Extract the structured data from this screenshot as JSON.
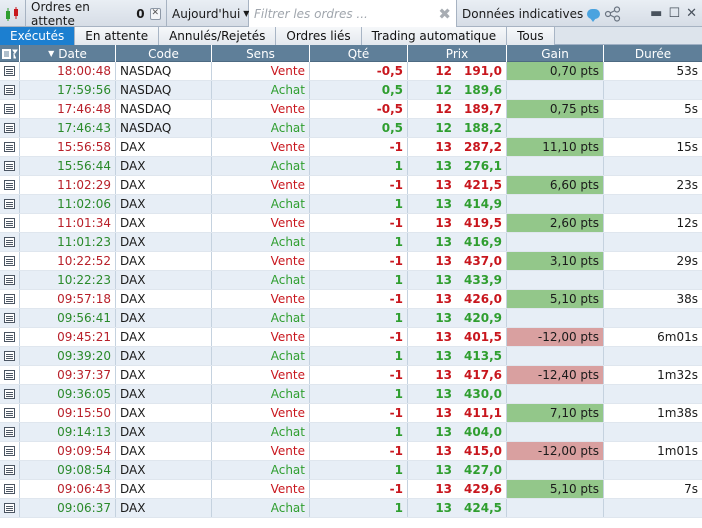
{
  "toolbar": {
    "title": "Ordres en attente",
    "pending_count": "0",
    "date_filter": "Aujourd'hui",
    "filter_placeholder": "Filtrer les ordres ...",
    "data_label": "Données indicatives"
  },
  "tabs": [
    {
      "label": "Exécutés",
      "active": true
    },
    {
      "label": "En attente",
      "active": false
    },
    {
      "label": "Annulés/Rejetés",
      "active": false
    },
    {
      "label": "Ordres liés",
      "active": false
    },
    {
      "label": "Trading automatique",
      "active": false
    },
    {
      "label": "Tous",
      "active": false
    }
  ],
  "columns": {
    "date": "Date",
    "code": "Code",
    "sens": "Sens",
    "qte": "Qté",
    "prix": "Prix",
    "gain": "Gain",
    "duree": "Durée"
  },
  "colors": {
    "sell": "#c8161d",
    "buy": "#2f9e2f",
    "gain_positive": "#93c78a",
    "gain_negative": "#d9a0a0",
    "active_tab": "#1c7fd0",
    "header": "#5f7f99"
  },
  "rows": [
    {
      "date": "18:00:48",
      "code": "NASDAQ",
      "sens": "Vente",
      "qte": "-0,5",
      "prix_big": "12",
      "prix_small": "191,0",
      "gain": "0,70 pts",
      "duree": "53s"
    },
    {
      "date": "17:59:56",
      "code": "NASDAQ",
      "sens": "Achat",
      "qte": "0,5",
      "prix_big": "12",
      "prix_small": "189,6",
      "gain": "",
      "duree": ""
    },
    {
      "date": "17:46:48",
      "code": "NASDAQ",
      "sens": "Vente",
      "qte": "-0,5",
      "prix_big": "12",
      "prix_small": "189,7",
      "gain": "0,75 pts",
      "duree": "5s"
    },
    {
      "date": "17:46:43",
      "code": "NASDAQ",
      "sens": "Achat",
      "qte": "0,5",
      "prix_big": "12",
      "prix_small": "188,2",
      "gain": "",
      "duree": ""
    },
    {
      "date": "15:56:58",
      "code": "DAX",
      "sens": "Vente",
      "qte": "-1",
      "prix_big": "13",
      "prix_small": "287,2",
      "gain": "11,10 pts",
      "duree": "15s"
    },
    {
      "date": "15:56:44",
      "code": "DAX",
      "sens": "Achat",
      "qte": "1",
      "prix_big": "13",
      "prix_small": "276,1",
      "gain": "",
      "duree": ""
    },
    {
      "date": "11:02:29",
      "code": "DAX",
      "sens": "Vente",
      "qte": "-1",
      "prix_big": "13",
      "prix_small": "421,5",
      "gain": "6,60 pts",
      "duree": "23s"
    },
    {
      "date": "11:02:06",
      "code": "DAX",
      "sens": "Achat",
      "qte": "1",
      "prix_big": "13",
      "prix_small": "414,9",
      "gain": "",
      "duree": ""
    },
    {
      "date": "11:01:34",
      "code": "DAX",
      "sens": "Vente",
      "qte": "-1",
      "prix_big": "13",
      "prix_small": "419,5",
      "gain": "2,60 pts",
      "duree": "12s"
    },
    {
      "date": "11:01:23",
      "code": "DAX",
      "sens": "Achat",
      "qte": "1",
      "prix_big": "13",
      "prix_small": "416,9",
      "gain": "",
      "duree": ""
    },
    {
      "date": "10:22:52",
      "code": "DAX",
      "sens": "Vente",
      "qte": "-1",
      "prix_big": "13",
      "prix_small": "437,0",
      "gain": "3,10 pts",
      "duree": "29s"
    },
    {
      "date": "10:22:23",
      "code": "DAX",
      "sens": "Achat",
      "qte": "1",
      "prix_big": "13",
      "prix_small": "433,9",
      "gain": "",
      "duree": ""
    },
    {
      "date": "09:57:18",
      "code": "DAX",
      "sens": "Vente",
      "qte": "-1",
      "prix_big": "13",
      "prix_small": "426,0",
      "gain": "5,10 pts",
      "duree": "38s"
    },
    {
      "date": "09:56:41",
      "code": "DAX",
      "sens": "Achat",
      "qte": "1",
      "prix_big": "13",
      "prix_small": "420,9",
      "gain": "",
      "duree": ""
    },
    {
      "date": "09:45:21",
      "code": "DAX",
      "sens": "Vente",
      "qte": "-1",
      "prix_big": "13",
      "prix_small": "401,5",
      "gain": "-12,00 pts",
      "duree": "6m01s"
    },
    {
      "date": "09:39:20",
      "code": "DAX",
      "sens": "Achat",
      "qte": "1",
      "prix_big": "13",
      "prix_small": "413,5",
      "gain": "",
      "duree": ""
    },
    {
      "date": "09:37:37",
      "code": "DAX",
      "sens": "Vente",
      "qte": "-1",
      "prix_big": "13",
      "prix_small": "417,6",
      "gain": "-12,40 pts",
      "duree": "1m32s"
    },
    {
      "date": "09:36:05",
      "code": "DAX",
      "sens": "Achat",
      "qte": "1",
      "prix_big": "13",
      "prix_small": "430,0",
      "gain": "",
      "duree": ""
    },
    {
      "date": "09:15:50",
      "code": "DAX",
      "sens": "Vente",
      "qte": "-1",
      "prix_big": "13",
      "prix_small": "411,1",
      "gain": "7,10 pts",
      "duree": "1m38s"
    },
    {
      "date": "09:14:13",
      "code": "DAX",
      "sens": "Achat",
      "qte": "1",
      "prix_big": "13",
      "prix_small": "404,0",
      "gain": "",
      "duree": ""
    },
    {
      "date": "09:09:54",
      "code": "DAX",
      "sens": "Vente",
      "qte": "-1",
      "prix_big": "13",
      "prix_small": "415,0",
      "gain": "-12,00 pts",
      "duree": "1m01s"
    },
    {
      "date": "09:08:54",
      "code": "DAX",
      "sens": "Achat",
      "qte": "1",
      "prix_big": "13",
      "prix_small": "427,0",
      "gain": "",
      "duree": ""
    },
    {
      "date": "09:06:43",
      "code": "DAX",
      "sens": "Vente",
      "qte": "-1",
      "prix_big": "13",
      "prix_small": "429,6",
      "gain": "5,10 pts",
      "duree": "7s"
    },
    {
      "date": "09:06:37",
      "code": "DAX",
      "sens": "Achat",
      "qte": "1",
      "prix_big": "13",
      "prix_small": "424,5",
      "gain": "",
      "duree": ""
    }
  ]
}
